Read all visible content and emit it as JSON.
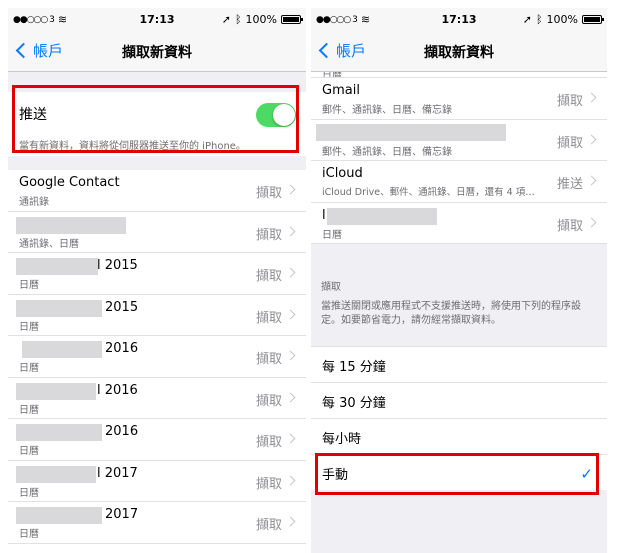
{
  "status_bar": {
    "carrier": "●●○○○ 3",
    "time": "17:13",
    "battery": "100%"
  },
  "nav": {
    "back_label": "帳戶",
    "title": "擷取新資料"
  },
  "left": {
    "push": {
      "label": "推送",
      "enabled": true,
      "footer": "當有新資料，資料將從伺服器推送至你的 iPhone。"
    },
    "accounts": [
      {
        "title": "Google Contact",
        "subtitle": "通訊錄",
        "value": "擷取"
      },
      {
        "title": "",
        "subtitle": "通訊錄、日曆",
        "value": "擷取"
      },
      {
        "title": "l 2015",
        "subtitle": "日曆",
        "value": "擷取"
      },
      {
        "title": "2015",
        "subtitle": "日曆",
        "value": "擷取"
      },
      {
        "title": "2016",
        "subtitle": "日曆",
        "value": "擷取"
      },
      {
        "title": "l 2016",
        "subtitle": "日曆",
        "value": "擷取"
      },
      {
        "title": "2016",
        "subtitle": "日曆",
        "value": "擷取"
      },
      {
        "title": "l 2017",
        "subtitle": "日曆",
        "value": "擷取"
      },
      {
        "title": "2017",
        "subtitle": "日曆",
        "value": "擷取"
      }
    ]
  },
  "right": {
    "top_partial_subtitle": "日曆",
    "accounts": [
      {
        "title": "Gmail",
        "subtitle": "郵件、通訊錄、日曆、備忘錄",
        "value": "擷取"
      },
      {
        "title": "",
        "subtitle": "郵件、通訊錄、日曆、備忘錄",
        "value": "擷取"
      },
      {
        "title": "iCloud",
        "subtitle": "iCloud Drive、郵件、通訊錄、日曆，還有 4 項…",
        "value": "推送"
      },
      {
        "title": "l",
        "subtitle": "日曆",
        "value": "擷取"
      }
    ],
    "fetch_section": {
      "header": "擷取",
      "footer": "當推送關閉或應用程式不支援推送時，將使用下列的程序設定。如要節省電力，請勿經常擷取資料。"
    },
    "schedule_options": [
      {
        "label": "每 15 分鐘",
        "selected": false
      },
      {
        "label": "每 30 分鐘",
        "selected": false
      },
      {
        "label": "每小時",
        "selected": false
      },
      {
        "label": "手動",
        "selected": true
      }
    ]
  },
  "colors": {
    "accent": "#007aff",
    "toggle_on": "#4cd964",
    "highlight": "#e00000"
  }
}
